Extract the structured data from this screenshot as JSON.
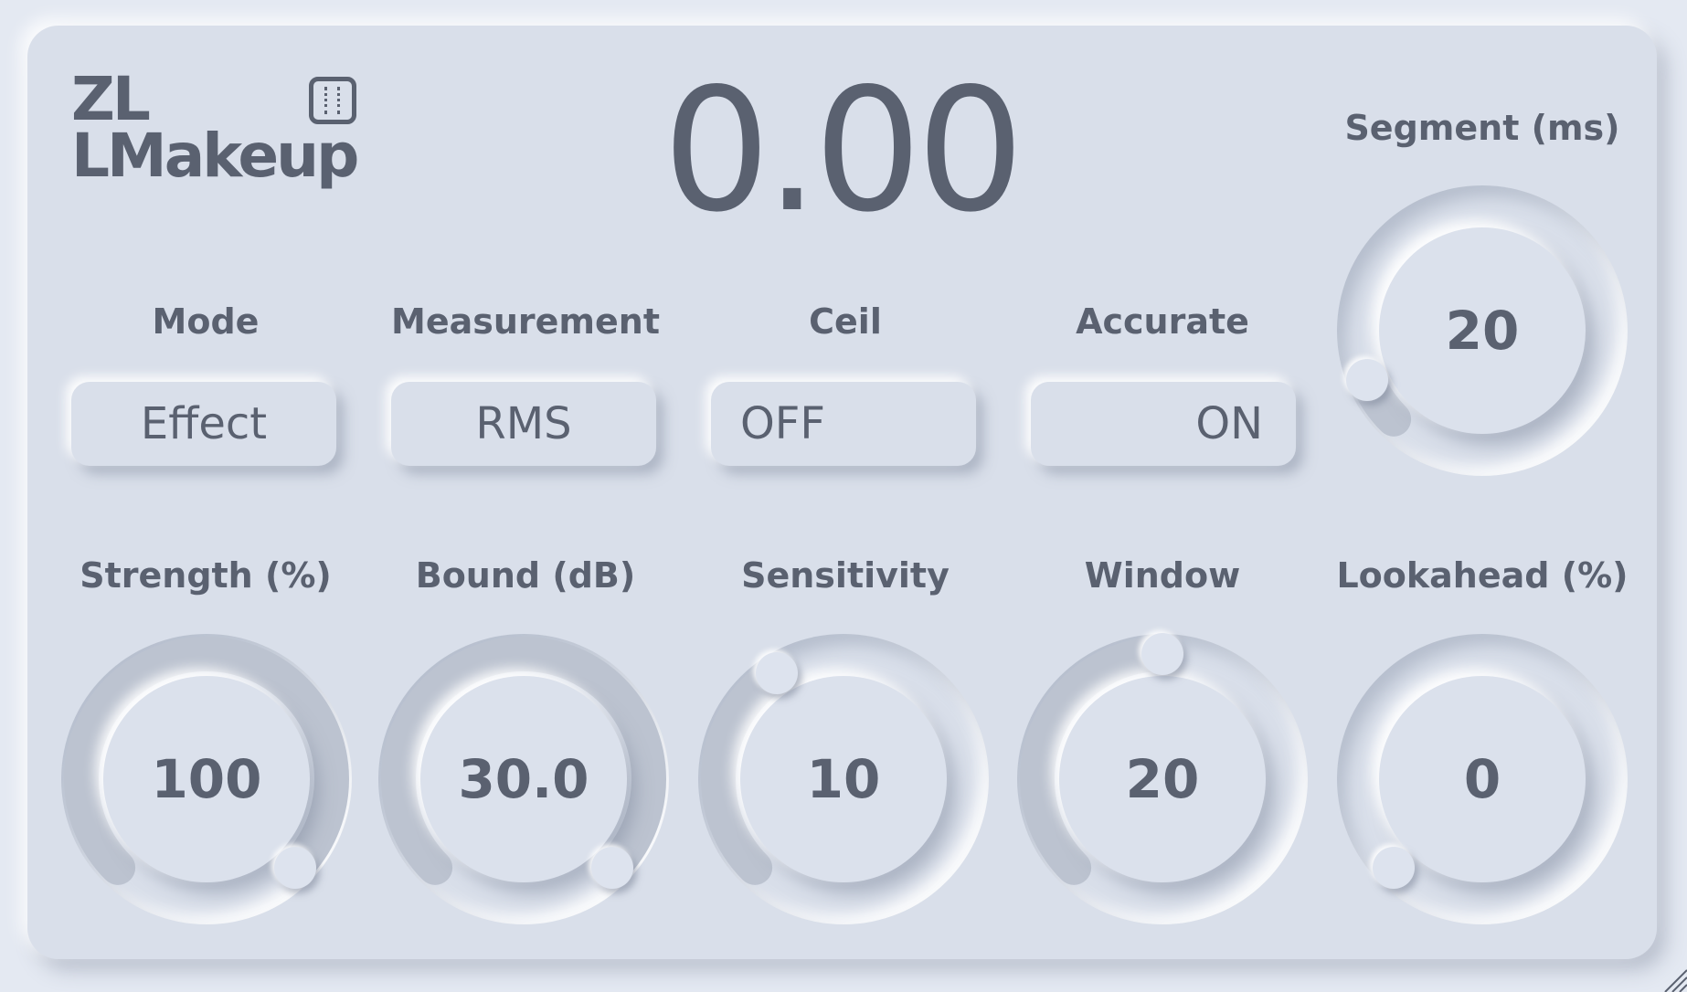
{
  "app": {
    "logo_line1": "ZL",
    "logo_line2": "LMakeup",
    "logo_icon": "ruler-panel-icon",
    "output_value": "0.00"
  },
  "buttons": [
    {
      "label": "Mode",
      "value": "Effect"
    },
    {
      "label": "Measurement",
      "value": "RMS"
    },
    {
      "label": "Ceil",
      "value": "OFF"
    },
    {
      "label": "Accurate",
      "value": "ON"
    }
  ],
  "knobs": [
    {
      "label": "Segment (ms)",
      "value": "20",
      "level": 0.08
    },
    {
      "label": "Strength (%)",
      "value": "100",
      "level": 1.0
    },
    {
      "label": "Bound (dB)",
      "value": "30.0",
      "level": 1.0
    },
    {
      "label": "Sensitivity",
      "value": "10",
      "level": 0.38
    },
    {
      "label": "Window",
      "value": "20",
      "level": 0.5
    },
    {
      "label": "Lookahead (%)",
      "value": "0",
      "level": 0.0
    }
  ],
  "colors": {
    "background": "#d9dfea",
    "text": "#5a6170",
    "track_fill": "#bcc3d0"
  }
}
